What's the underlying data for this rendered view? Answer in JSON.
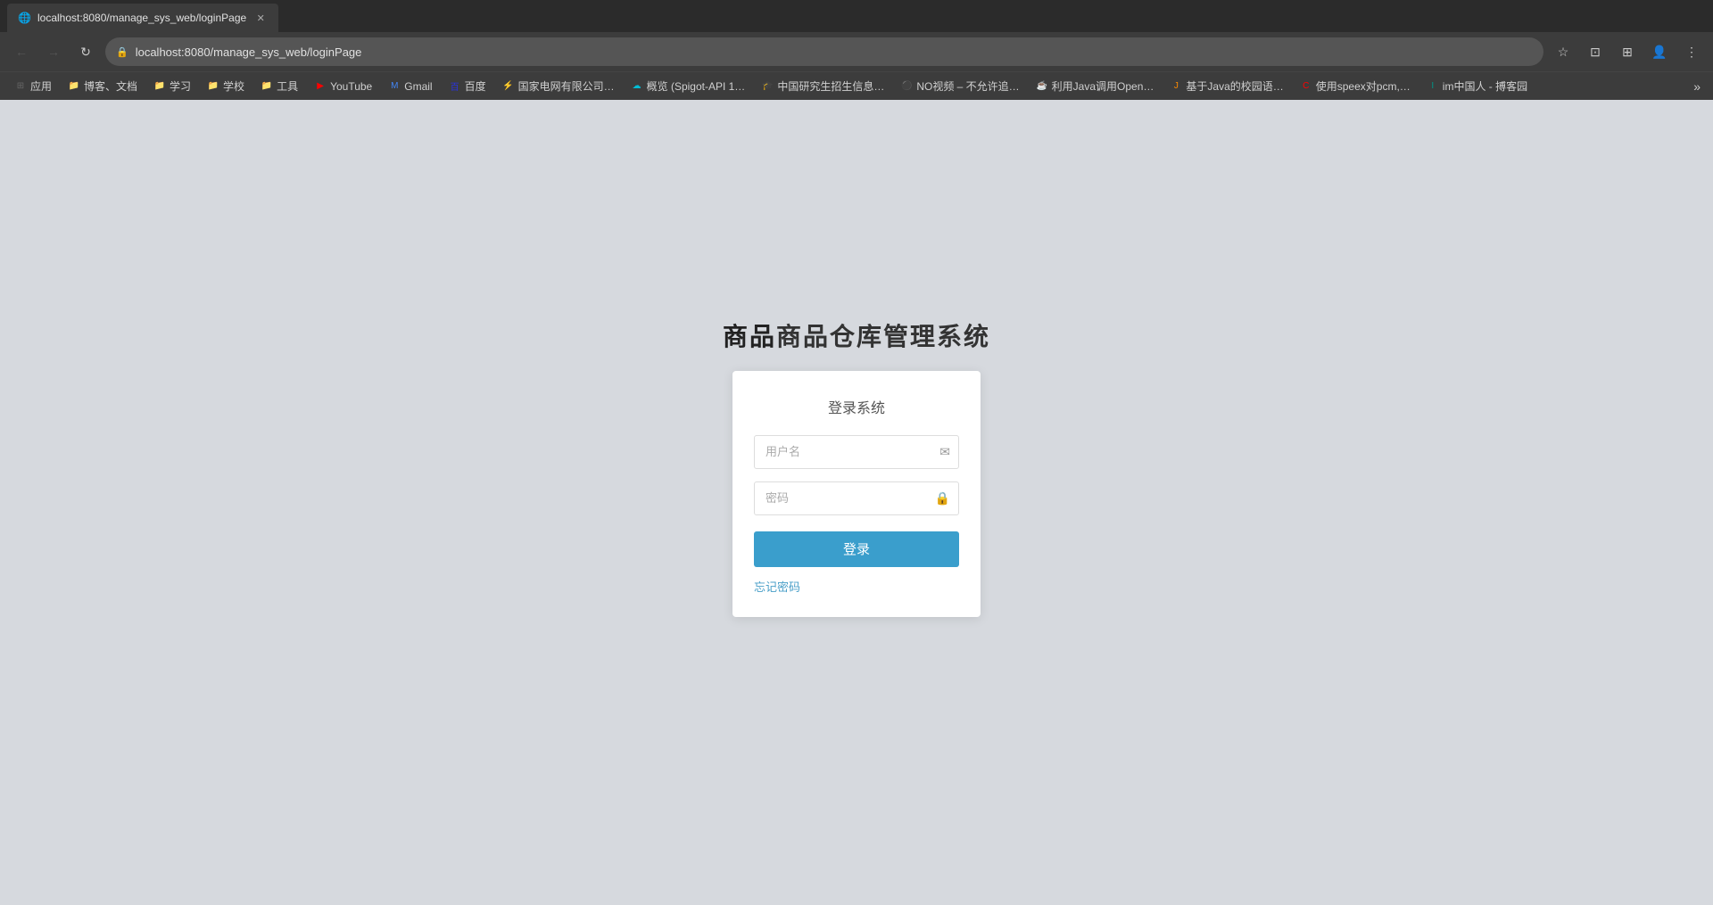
{
  "browser": {
    "tab": {
      "title": "localhost:8080/manage_sys_web/loginPage",
      "favicon": "🌐"
    },
    "address_bar": {
      "url": "localhost:8080/manage_sys_web/loginPage",
      "lock_icon": "🔒"
    },
    "nav": {
      "back_disabled": true,
      "forward_disabled": true
    }
  },
  "bookmarks": [
    {
      "id": "apps",
      "label": "应用",
      "favicon": "⊞",
      "color": "bm-apps"
    },
    {
      "id": "blog",
      "label": "博客、文档",
      "favicon": "📁",
      "color": "bm-yellow"
    },
    {
      "id": "study",
      "label": "学习",
      "favicon": "📁",
      "color": "bm-blue"
    },
    {
      "id": "school",
      "label": "学校",
      "favicon": "📁",
      "color": "bm-yellow"
    },
    {
      "id": "tools",
      "label": "工具",
      "favicon": "📁",
      "color": "bm-yellow"
    },
    {
      "id": "youtube",
      "label": "YouTube",
      "favicon": "▶",
      "color": "bm-red"
    },
    {
      "id": "gmail",
      "label": "Gmail",
      "favicon": "M",
      "color": "bm-google-blue"
    },
    {
      "id": "baidu",
      "label": "百度",
      "favicon": "百",
      "color": "bm-baidu"
    },
    {
      "id": "guodian",
      "label": "国家电网有限公司…",
      "favicon": "⚡",
      "color": "bm-orange"
    },
    {
      "id": "gailan",
      "label": "概览 (Spigot-API 1…",
      "favicon": "☁",
      "color": "bm-cyan"
    },
    {
      "id": "zhongguo",
      "label": "中国研究生招生信息…",
      "favicon": "🎓",
      "color": "bm-teal"
    },
    {
      "id": "novideo",
      "label": "NO视频 – 不允许追…",
      "favicon": "⚫",
      "color": "bm-purple"
    },
    {
      "id": "java1",
      "label": "利用Java调用Open…",
      "favicon": "☕",
      "color": "bm-green"
    },
    {
      "id": "java2",
      "label": "基于Java的校园语…",
      "favicon": "J",
      "color": "bm-orange"
    },
    {
      "id": "speex",
      "label": "使用speex对pcm,…",
      "favicon": "C",
      "color": "bm-red"
    },
    {
      "id": "im",
      "label": "im中国人 - 搏客园",
      "favicon": "I",
      "color": "bm-teal"
    }
  ],
  "page": {
    "app_title_bold": "商品",
    "app_title_rest": "商品仓库管理系统",
    "login_card": {
      "title": "登录系统",
      "username_placeholder": "用户名",
      "password_placeholder": "密码",
      "login_button_label": "登录",
      "forgot_password_label": "忘记密码"
    }
  }
}
